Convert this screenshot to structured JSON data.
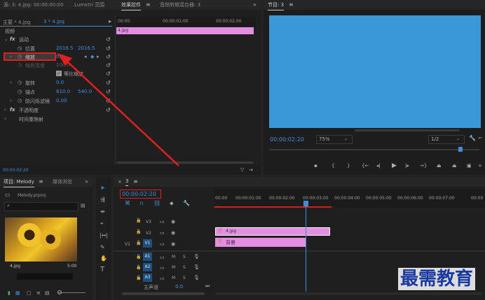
{
  "effect_controls": {
    "top_tabs": [
      "源: 3: 4.jpg: 00:00:00:00",
      "Lumetri 范围",
      "效果控件",
      "音频剪辑混合器: 3"
    ],
    "master": "主要 * 4.jpg",
    "clip": "3 * 4.jpg",
    "section_video": "视频",
    "fx_motion": "运动",
    "position_label": "位置",
    "position_x": "2016.5",
    "position_y": "2016.5",
    "scale_label": "缩放",
    "scale_value": "0.0",
    "scale_width_label": "缩放宽度",
    "scale_width_value": "100.0",
    "uniform_scale_label": "等比缩放",
    "rotation_label": "旋转",
    "rotation_value": "0.0",
    "anchor_label": "锚点",
    "anchor_x": "810.0",
    "anchor_y": "540.0",
    "antiflicker_label": "防闪烁滤镜",
    "antiflicker_value": "0.00",
    "opacity_label": "不透明度",
    "time_remap_label": "时间重映射",
    "ruler": [
      "00:00",
      "00:00:01:00",
      "00:00:02:00"
    ],
    "clip_name": "4.jpg",
    "timecode": "00:00:02:20"
  },
  "program": {
    "title": "节目: 3",
    "timecode": "00:00:02:20",
    "zoom": "75%",
    "quality": "1/2",
    "screen_color": "#3a97d8"
  },
  "project": {
    "tab_project": "项目: Melody",
    "tab_media": "媒体浏览",
    "project_file": "Melody.prproj",
    "thumb_name": "4.jpg",
    "thumb_duration": "5:00"
  },
  "timeline": {
    "tab": "3",
    "timecode": "00:00:02:20",
    "ruler": [
      "00:00",
      "00:00:01:00",
      "00:00:02:00",
      "00:00:03:00",
      "00:00:04:00",
      "00:00:05:00",
      "00:00:06:00",
      "00:00:07:00",
      "00:00"
    ],
    "video_tracks": [
      "V3",
      "V2",
      "V1"
    ],
    "audio_tracks": [
      "A1",
      "A2",
      "A3"
    ],
    "source_v1": "V1",
    "master_label": "主声道",
    "master_value": "0.0",
    "clip_top": "4.jpg",
    "clip_bottom": "背景",
    "clip_color": "#e48ee2"
  },
  "watermark": "最需教育"
}
